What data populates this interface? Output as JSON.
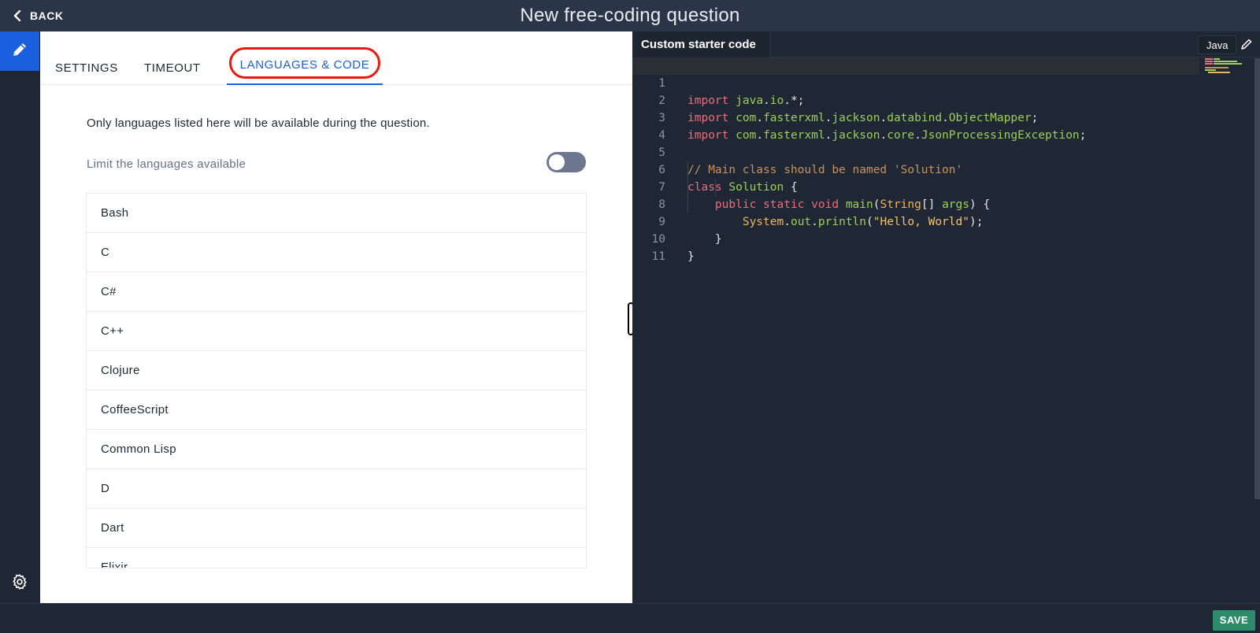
{
  "header": {
    "back_label": "BACK",
    "title": "New free-coding question"
  },
  "rail": {
    "edit_icon": "pencil-icon",
    "settings_icon": "gear-icon",
    "accent": "#1a5fe0"
  },
  "tabs": [
    {
      "label": "SETTINGS",
      "active": false
    },
    {
      "label": "TIMEOUT",
      "active": false
    },
    {
      "label": "LANGUAGES & CODE",
      "active": true
    }
  ],
  "languages": {
    "description": "Only languages listed here will be available during the question.",
    "limit_label": "Limit the languages available",
    "limit_enabled": false,
    "items": [
      "Bash",
      "C",
      "C#",
      "C++",
      "Clojure",
      "CoffeeScript",
      "Common Lisp",
      "D",
      "Dart",
      "Elixir"
    ]
  },
  "editor": {
    "tab_label": "Custom starter code",
    "language": "Java",
    "line_numbers": [
      "1",
      "2",
      "3",
      "4",
      "5",
      "6",
      "7",
      "8",
      "9",
      "10",
      "11"
    ]
  },
  "footer": {
    "save_label": "SAVE",
    "save_color": "#2e8b6a"
  },
  "annotation": {
    "highlight_color": "#e8190f"
  }
}
